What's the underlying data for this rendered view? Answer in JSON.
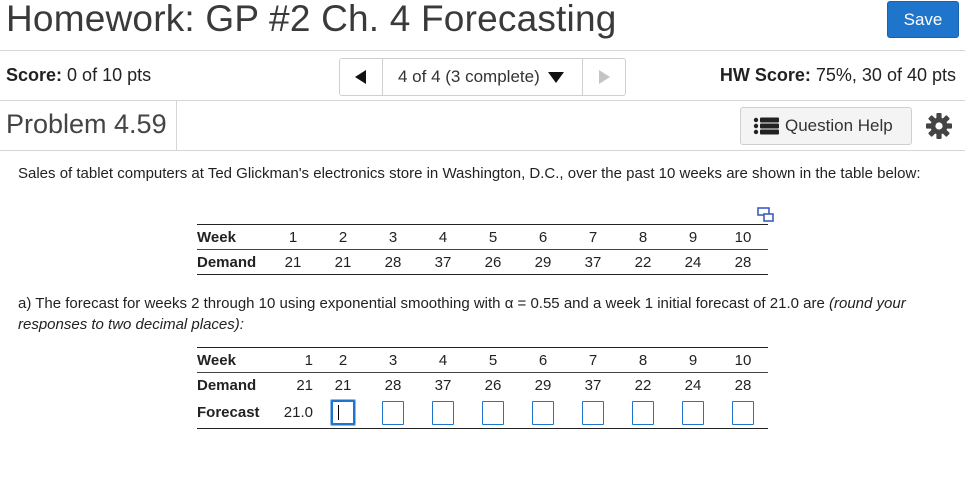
{
  "header": {
    "title": "Homework: GP #2 Ch. 4 Forecasting",
    "save_label": "Save"
  },
  "score_bar": {
    "score_label": "Score:",
    "score_value": "0 of 10 pts",
    "nav_label": "4 of 4 (3 complete)",
    "hw_score_label": "HW Score:",
    "hw_score_value": "75%, 30 of 40 pts"
  },
  "problem_bar": {
    "title": "Problem 4.59",
    "question_help_label": "Question Help"
  },
  "problem": {
    "intro": "Sales of tablet computers at Ted Glickman's electronics store in Washington, D.C., over the past 10 weeks are shown in the table below:",
    "table1": {
      "week_label": "Week",
      "demand_label": "Demand",
      "weeks": [
        "1",
        "2",
        "3",
        "4",
        "5",
        "6",
        "7",
        "8",
        "9",
        "10"
      ],
      "demand": [
        "21",
        "21",
        "28",
        "37",
        "26",
        "29",
        "37",
        "22",
        "24",
        "28"
      ]
    },
    "part_a_text": "a) The forecast for weeks 2 through 10 using exponential smoothing with",
    "alpha_symbol": "α",
    "part_a_text2": "= 0.55 and a week 1 initial forecast of 21.0 are",
    "part_a_italic": "(round your responses to two decimal places):",
    "table2": {
      "week_label": "Week",
      "demand_label": "Demand",
      "forecast_label": "Forecast",
      "weeks": [
        "1",
        "2",
        "3",
        "4",
        "5",
        "6",
        "7",
        "8",
        "9",
        "10"
      ],
      "demand": [
        "21",
        "21",
        "28",
        "37",
        "26",
        "29",
        "37",
        "22",
        "24",
        "28"
      ],
      "forecast_week1": "21.0",
      "forecast_inputs": [
        "",
        "",
        "",
        "",
        "",
        "",
        "",
        "",
        ""
      ]
    }
  },
  "colors": {
    "accent": "#1f75cc",
    "border": "#d6d6d6"
  },
  "icons": {
    "save": "none",
    "prev": "triangle-left-icon",
    "next": "triangle-right-icon",
    "dropdown": "triangle-down-icon",
    "question_help": "list-icon",
    "settings": "gear-icon",
    "expand": "expand-table-icon"
  }
}
